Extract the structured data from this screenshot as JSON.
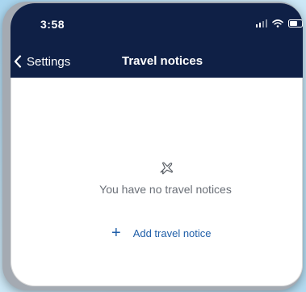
{
  "status_bar": {
    "time": "3:58",
    "icons": [
      "signal-icon",
      "wifi-icon",
      "battery-icon"
    ]
  },
  "nav": {
    "back_label": "Settings",
    "title": "Travel notices"
  },
  "empty_state": {
    "icon": "airplane-icon",
    "message": "You have no travel notices"
  },
  "actions": {
    "add_label": "Add travel notice",
    "add_icon": "plus-icon"
  },
  "colors": {
    "header": "#0f2046",
    "accent": "#1f5ea8",
    "text_secondary": "#6a6f77",
    "background": "#ffffff"
  }
}
